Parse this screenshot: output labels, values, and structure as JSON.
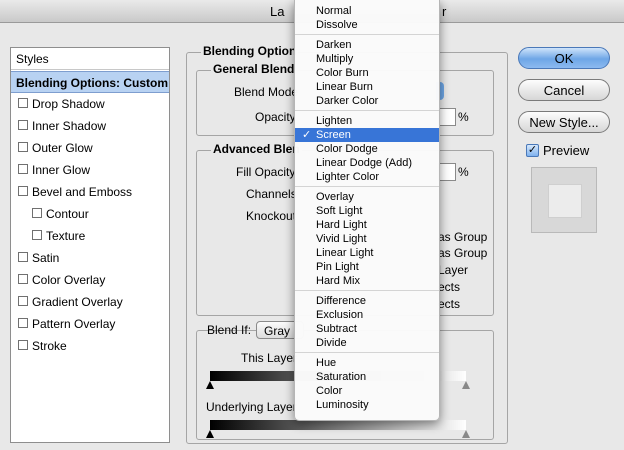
{
  "window": {
    "title_left": "La",
    "title_right": "r"
  },
  "styles_panel": {
    "header": "Styles",
    "selected": "Blending Options: Custom",
    "items": [
      {
        "label": "Drop Shadow",
        "indent": false
      },
      {
        "label": "Inner Shadow",
        "indent": false
      },
      {
        "label": "Outer Glow",
        "indent": false
      },
      {
        "label": "Inner Glow",
        "indent": false
      },
      {
        "label": "Bevel and Emboss",
        "indent": false
      },
      {
        "label": "Contour",
        "indent": true
      },
      {
        "label": "Texture",
        "indent": true
      },
      {
        "label": "Satin",
        "indent": false
      },
      {
        "label": "Color Overlay",
        "indent": false
      },
      {
        "label": "Gradient Overlay",
        "indent": false
      },
      {
        "label": "Pattern Overlay",
        "indent": false
      },
      {
        "label": "Stroke",
        "indent": false
      }
    ]
  },
  "blending": {
    "legend": "Blending Option",
    "general": {
      "legend": "General Blend",
      "blend_mode_label": "Blend Mode",
      "opacity_label": "Opacity",
      "opacity_unit": "%"
    },
    "advanced": {
      "legend": "Advanced Blen",
      "fill_opacity_label": "Fill Opacity",
      "fill_opacity_unit": "%",
      "channels_label": "Channels",
      "knockout_label": "Knockout",
      "right_fragments": [
        "as Group",
        "as Group",
        "Layer",
        "ects",
        "ects"
      ]
    },
    "blend_if": {
      "label": "Blend If:",
      "value": "Gray",
      "this_layer_label": "This Layer",
      "underlying_layer_label": "Underlying Layer"
    }
  },
  "buttons": {
    "ok": "OK",
    "cancel": "Cancel",
    "new_style": "New Style..."
  },
  "preview": {
    "label": "Preview",
    "checked": true
  },
  "blend_menu": {
    "selected": "Screen",
    "groups": [
      [
        "Normal",
        "Dissolve"
      ],
      [
        "Darken",
        "Multiply",
        "Color Burn",
        "Linear Burn",
        "Darker Color"
      ],
      [
        "Lighten",
        "Screen",
        "Color Dodge",
        "Linear Dodge (Add)",
        "Lighter Color"
      ],
      [
        "Overlay",
        "Soft Light",
        "Hard Light",
        "Vivid Light",
        "Linear Light",
        "Pin Light",
        "Hard Mix"
      ],
      [
        "Difference",
        "Exclusion",
        "Subtract",
        "Divide"
      ],
      [
        "Hue",
        "Saturation",
        "Color",
        "Luminosity"
      ]
    ]
  },
  "colors": {
    "accent": "#3875d7",
    "selection_bg": "#b8d2f2"
  }
}
